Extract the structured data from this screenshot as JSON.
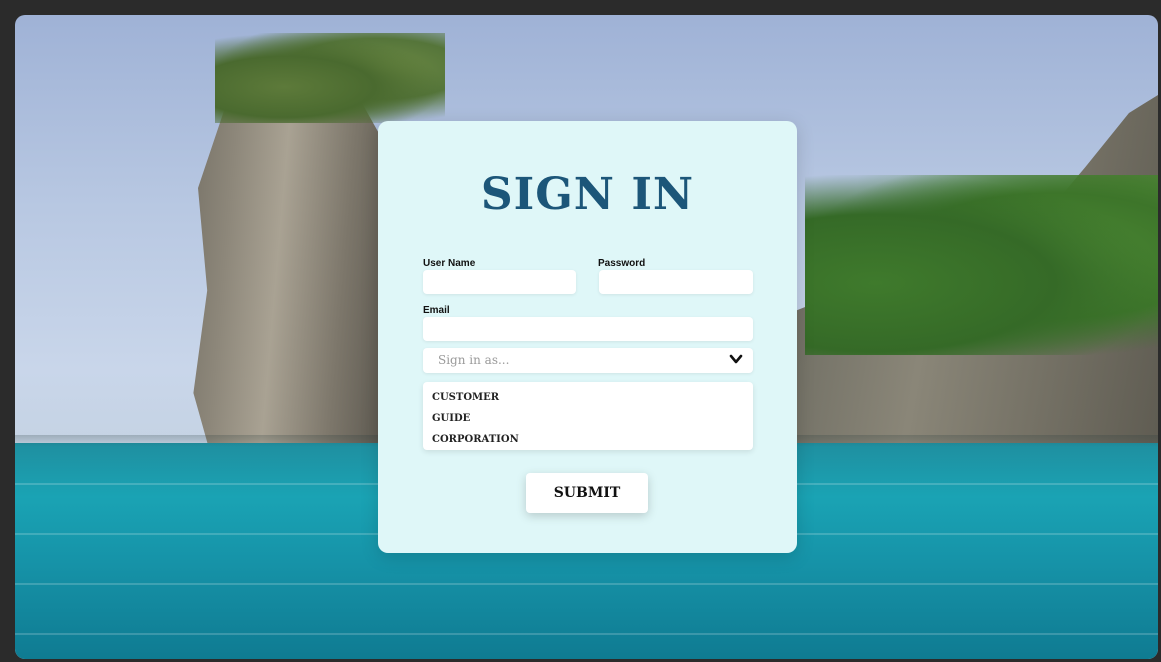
{
  "form": {
    "title": "SIGN IN",
    "username_label": "User Name",
    "username_value": "",
    "password_label": "Password",
    "password_value": "",
    "email_label": "Email",
    "email_value": "",
    "role_placeholder": "Sign in as...",
    "role_options": [
      "CUSTOMER",
      "GUIDE",
      "CORPORATION"
    ],
    "submit_label": "SUBMIT"
  },
  "colors": {
    "card_background": "#dff7f8",
    "title_color": "#1c5679"
  },
  "icons": {
    "dropdown": "chevron-down-icon"
  }
}
